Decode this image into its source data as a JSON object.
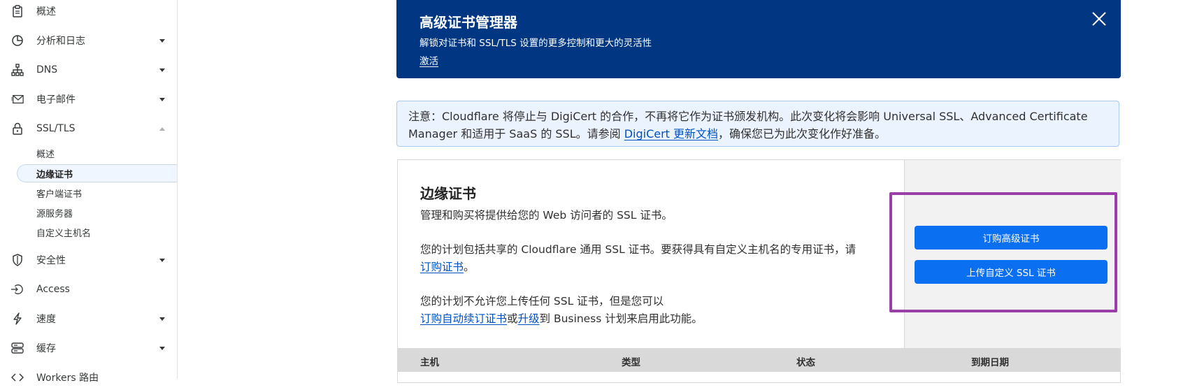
{
  "sidebar": {
    "items": [
      {
        "label": "概述",
        "icon": "clipboard-icon",
        "caret": "none"
      },
      {
        "label": "分析和日志",
        "icon": "chart-pie-icon",
        "caret": "down"
      },
      {
        "label": "DNS",
        "icon": "network-icon",
        "caret": "down"
      },
      {
        "label": "电子邮件",
        "icon": "mail-icon",
        "caret": "down"
      },
      {
        "label": "SSL/TLS",
        "icon": "lock-icon",
        "caret": "up"
      },
      {
        "label": "安全性",
        "icon": "shield-icon",
        "caret": "down"
      },
      {
        "label": "Access",
        "icon": "access-icon",
        "caret": "none"
      },
      {
        "label": "速度",
        "icon": "bolt-icon",
        "caret": "down"
      },
      {
        "label": "缓存",
        "icon": "server-icon",
        "caret": "down"
      },
      {
        "label": "Workers 路由",
        "icon": "code-icon",
        "caret": "none"
      }
    ],
    "ssl_sub_items": [
      {
        "label": "概述"
      },
      {
        "label": "边缘证书",
        "active": true
      },
      {
        "label": "客户端证书"
      },
      {
        "label": "源服务器"
      },
      {
        "label": "自定义主机名"
      }
    ]
  },
  "banner": {
    "title": "高级证书管理器",
    "description": "解锁对证书和 SSL/TLS 设置的更多控制和更大的灵活性",
    "link": "激活"
  },
  "notice": {
    "prefix": "注意：Cloudflare 将停止与 DigiCert 的合作，不再将它作为证书颁发机构。此次变化将会影响 Universal SSL、Advanced Certificate Manager 和适用于 SaaS 的 SSL。请参阅 ",
    "link": "DigiCert 更新文档",
    "suffix": "，确保您已为此次变化作好准备。"
  },
  "edge_certs": {
    "title": "边缘证书",
    "subtitle": "管理和购买将提供给您的 Web 访问者的 SSL 证书。",
    "plan_text": "您的计划包括共享的 Cloudflare 通用 SSL 证书。要获得具有自定义主机名的专用证书，请",
    "plan_link": "订购证书",
    "plan_end": "。",
    "upload_text": "您的计划不允许您上传任何 SSL 证书，但是您可以",
    "upload_link1": "订购自动续订证书",
    "upload_mid": "或",
    "upload_link2": "升级",
    "upload_end": "到 Business 计划来启用此功能。",
    "order_button": "订购高级证书",
    "upload_button": "上传自定义 SSL 证书"
  },
  "table": {
    "columns": [
      "主机",
      "类型",
      "状态",
      "到期日期"
    ]
  },
  "colors": {
    "banner_bg": "#003682",
    "button": "#0a6ff0",
    "link": "#0051c3",
    "highlight": "#9b3fa8"
  }
}
